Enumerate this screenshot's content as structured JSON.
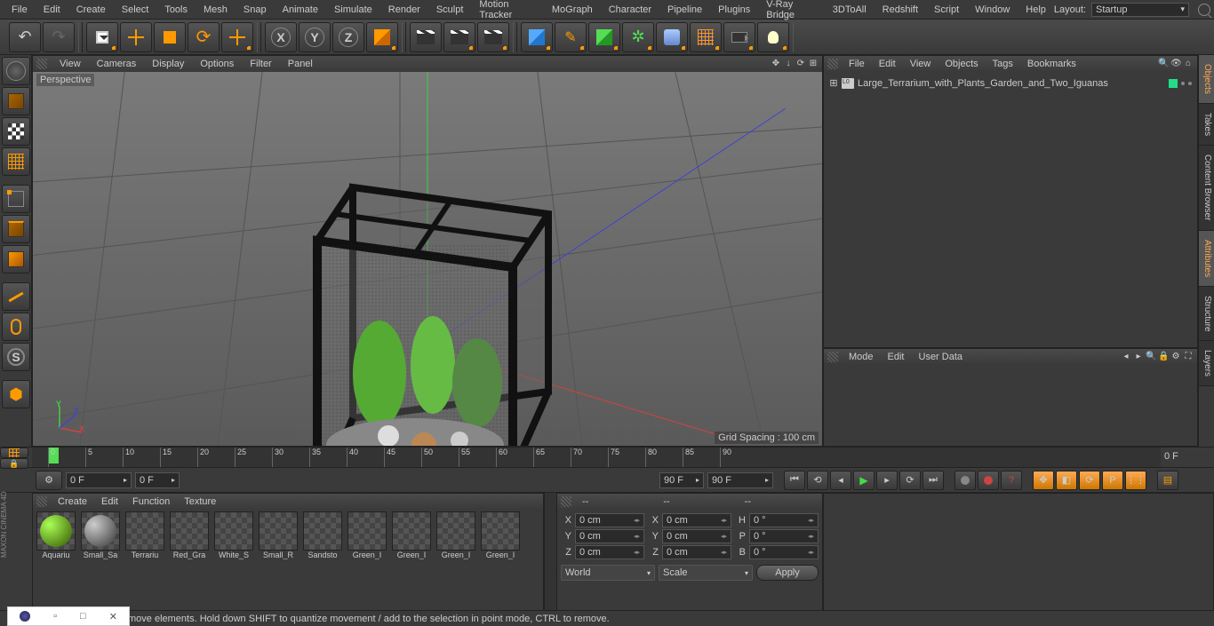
{
  "menubar": [
    "File",
    "Edit",
    "Create",
    "Select",
    "Tools",
    "Mesh",
    "Snap",
    "Animate",
    "Simulate",
    "Render",
    "Sculpt",
    "Motion Tracker",
    "MoGraph",
    "Character",
    "Pipeline",
    "Plugins",
    "V-Ray Bridge",
    "3DToAll",
    "Redshift",
    "Script",
    "Window",
    "Help"
  ],
  "layout": {
    "label": "Layout:",
    "value": "Startup"
  },
  "viewport": {
    "menus": [
      "View",
      "Cameras",
      "Display",
      "Options",
      "Filter",
      "Panel"
    ],
    "label": "Perspective",
    "grid_spacing": "Grid Spacing : 100 cm"
  },
  "objects_panel": {
    "menus": [
      "File",
      "Edit",
      "View",
      "Objects",
      "Tags",
      "Bookmarks"
    ],
    "item": "Large_Terrarium_with_Plants_Garden_and_Two_Iguanas"
  },
  "attr_panel": {
    "menus": [
      "Mode",
      "Edit",
      "User Data"
    ]
  },
  "right_tabs": [
    "Objects",
    "Takes",
    "Content Browser",
    "Attributes",
    "Structure",
    "Layers"
  ],
  "timeline": {
    "ticks": [
      0,
      5,
      10,
      15,
      20,
      25,
      30,
      35,
      40,
      45,
      50,
      55,
      60,
      65,
      70,
      75,
      80,
      85,
      90
    ],
    "end": "0 F",
    "f1": "0 F",
    "f2": "0 F",
    "f3": "90 F",
    "f4": "90 F"
  },
  "materials": {
    "menus": [
      "Create",
      "Edit",
      "Function",
      "Texture"
    ],
    "items": [
      "Aquariu",
      "Small_Sa",
      "Terrariu",
      "Red_Gra",
      "White_S",
      "Small_R",
      "Sandsto",
      "Green_I",
      "Green_I",
      "Green_I",
      "Green_I"
    ]
  },
  "coords": {
    "header": [
      "--",
      "--",
      "--"
    ],
    "rows": [
      {
        "a": "X",
        "av": "0 cm",
        "b": "X",
        "bv": "0 cm",
        "c": "H",
        "cv": "0 °"
      },
      {
        "a": "Y",
        "av": "0 cm",
        "b": "Y",
        "bv": "0 cm",
        "c": "P",
        "cv": "0 °"
      },
      {
        "a": "Z",
        "av": "0 cm",
        "b": "Z",
        "bv": "0 cm",
        "c": "B",
        "cv": "0 °"
      }
    ],
    "dd1": "World",
    "dd2": "Scale",
    "apply": "Apply"
  },
  "status": "move elements. Hold down SHIFT to quantize movement / add to the selection in point mode, CTRL to remove.",
  "logo": "MAXON CINEMA 4D"
}
